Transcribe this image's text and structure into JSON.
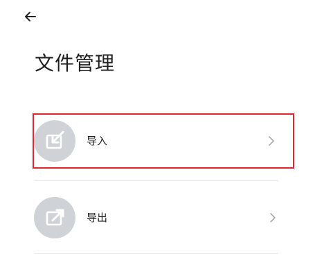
{
  "page": {
    "title": "文件管理"
  },
  "menu": {
    "items": [
      {
        "label": "导入",
        "icon": "import-icon"
      },
      {
        "label": "导出",
        "icon": "export-icon"
      }
    ]
  },
  "colors": {
    "highlight_border": "#e0262d",
    "icon_circle": "#cfd2d7",
    "divider": "#e6e6e6",
    "chevron": "#9a9a9a"
  }
}
